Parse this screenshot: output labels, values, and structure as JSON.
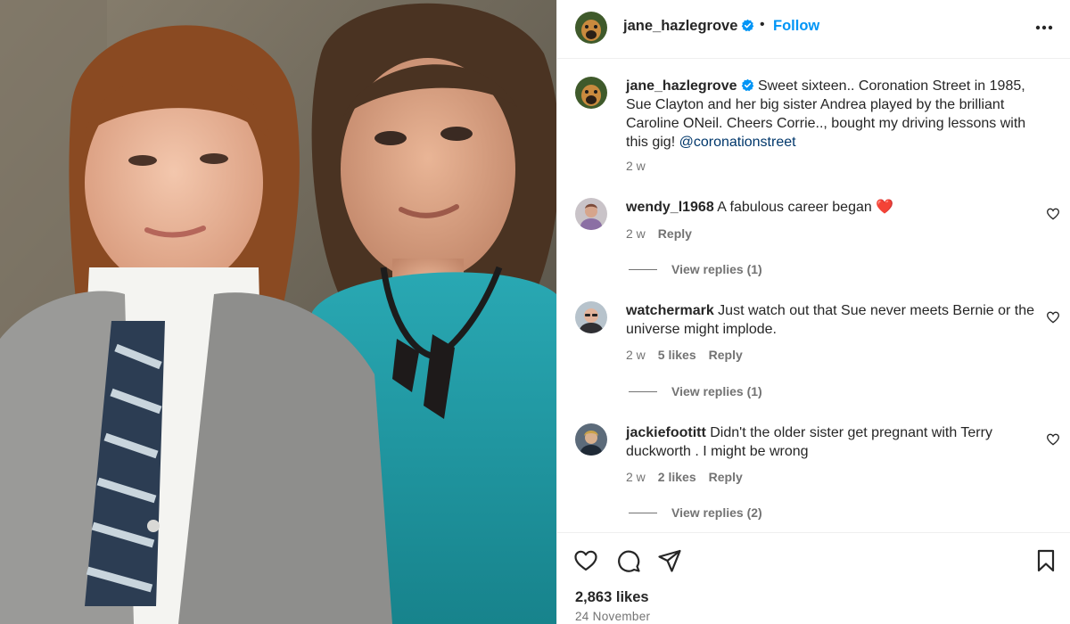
{
  "post": {
    "username": "jane_hazlegrove",
    "follow_label": "Follow",
    "separator": "•",
    "caption": {
      "username": "jane_hazlegrove",
      "text_main": "Sweet sixteen.. Coronation Street in 1985, Sue Clayton and her big sister Andrea played by the brilliant Caroline ONeil. Cheers Corrie.., bought my driving lessons with this gig!",
      "mention": "@coronationstreet",
      "time": "2 w"
    },
    "likes": "2,863 likes",
    "date": "24 November"
  },
  "comments": [
    {
      "username": "wendy_l1968",
      "text": "A fabulous career began",
      "emoji": "❤️",
      "time": "2 w",
      "likes": "",
      "reply_label": "Reply",
      "view_replies": "View replies (1)"
    },
    {
      "username": "watchermark",
      "text": "Just watch out that Sue never meets Bernie or the universe might implode.",
      "emoji": "",
      "time": "2 w",
      "likes": "5 likes",
      "reply_label": "Reply",
      "view_replies": "View replies (1)"
    },
    {
      "username": "jackiefootitt",
      "text": "Didn't the older sister get pregnant with Terry duckworth . I might be wrong",
      "emoji": "",
      "time": "2 w",
      "likes": "2 likes",
      "reply_label": "Reply",
      "view_replies": "View replies (2)"
    }
  ],
  "icons": {
    "more": "more-horizontal-icon",
    "verified": "verified-badge-icon",
    "like": "heart-icon",
    "comment": "comment-icon",
    "share": "share-icon",
    "save": "bookmark-icon"
  },
  "colors": {
    "accent": "#0095f6",
    "verified": "#0095f6",
    "mention": "#00376b",
    "secondary_text": "#737373",
    "emoji_heart": "#e0245e"
  }
}
